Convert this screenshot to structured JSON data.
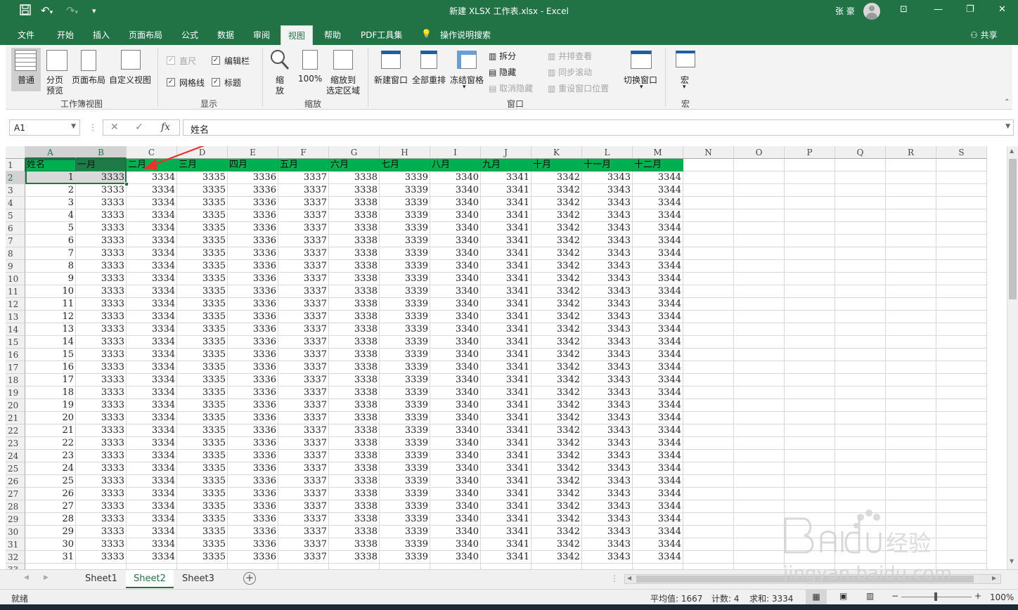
{
  "window": {
    "title": "新建 XLSX 工作表.xlsx  -  Excel",
    "user_name": "张 豪"
  },
  "tabs": [
    {
      "label": "文件"
    },
    {
      "label": "开始"
    },
    {
      "label": "插入"
    },
    {
      "label": "页面布局"
    },
    {
      "label": "公式"
    },
    {
      "label": "数据"
    },
    {
      "label": "审阅"
    },
    {
      "label": "视图"
    },
    {
      "label": "帮助"
    },
    {
      "label": "PDF工具集"
    },
    {
      "label": "操作说明搜索"
    }
  ],
  "share_label": "共享",
  "ribbon": {
    "views": {
      "normal": "普通",
      "pagebreak_1": "分页",
      "pagebreak_2": "预览",
      "pagelayout": "页面布局",
      "custom": "自定义视图",
      "group": "工作簿视图"
    },
    "show": {
      "ruler": "直尺",
      "formulabar": "编辑栏",
      "gridlines": "网格线",
      "headings": "标题",
      "group": "显示"
    },
    "zoom": {
      "zoom_1": "缩",
      "zoom_2": "放",
      "hundred": "100%",
      "tosel_1": "缩放到",
      "tosel_2": "选定区域",
      "group": "缩放"
    },
    "window": {
      "newwin": "新建窗口",
      "arrange": "全部重排",
      "freeze": "冻结窗格",
      "split": "拆分",
      "hide": "隐藏",
      "unhide": "取消隐藏",
      "sidebyside": "并排查看",
      "syncscroll": "同步滚动",
      "resetpos": "重设窗口位置",
      "switch": "切换窗口",
      "group": "窗口"
    },
    "macros": {
      "label": "宏",
      "group": "宏"
    }
  },
  "formula_bar": {
    "name_box": "A1",
    "formula": "姓名"
  },
  "columns": [
    "A",
    "B",
    "C",
    "D",
    "E",
    "F",
    "G",
    "H",
    "I",
    "J",
    "K",
    "L",
    "M",
    "N",
    "O",
    "P",
    "Q",
    "R",
    "S"
  ],
  "header_row": [
    "姓名",
    "一月",
    "二月",
    "三月",
    "四月",
    "五月",
    "六月",
    "七月",
    "八月",
    "九月",
    "十月",
    "十一月",
    "十二月"
  ],
  "rows": [
    {
      "row": "2",
      "name": "1",
      "vals": [
        "3333",
        "3334",
        "3335",
        "3336",
        "3337",
        "3338",
        "3339",
        "3340",
        "3341",
        "3342",
        "3343",
        "3344"
      ]
    },
    {
      "row": "3",
      "name": "2",
      "vals": [
        "3333",
        "3334",
        "3335",
        "3336",
        "3337",
        "3338",
        "3339",
        "3340",
        "3341",
        "3342",
        "3343",
        "3344"
      ]
    },
    {
      "row": "4",
      "name": "3",
      "vals": [
        "3333",
        "3334",
        "3335",
        "3336",
        "3337",
        "3338",
        "3339",
        "3340",
        "3341",
        "3342",
        "3343",
        "3344"
      ]
    },
    {
      "row": "5",
      "name": "4",
      "vals": [
        "3333",
        "3334",
        "3335",
        "3336",
        "3337",
        "3338",
        "3339",
        "3340",
        "3341",
        "3342",
        "3343",
        "3344"
      ]
    },
    {
      "row": "6",
      "name": "5",
      "vals": [
        "3333",
        "3334",
        "3335",
        "3336",
        "3337",
        "3338",
        "3339",
        "3340",
        "3341",
        "3342",
        "3343",
        "3344"
      ]
    },
    {
      "row": "7",
      "name": "6",
      "vals": [
        "3333",
        "3334",
        "3335",
        "3336",
        "3337",
        "3338",
        "3339",
        "3340",
        "3341",
        "3342",
        "3343",
        "3344"
      ]
    },
    {
      "row": "8",
      "name": "7",
      "vals": [
        "3333",
        "3334",
        "3335",
        "3336",
        "3337",
        "3338",
        "3339",
        "3340",
        "3341",
        "3342",
        "3343",
        "3344"
      ]
    },
    {
      "row": "9",
      "name": "8",
      "vals": [
        "3333",
        "3334",
        "3335",
        "3336",
        "3337",
        "3338",
        "3339",
        "3340",
        "3341",
        "3342",
        "3343",
        "3344"
      ]
    },
    {
      "row": "10",
      "name": "9",
      "vals": [
        "3333",
        "3334",
        "3335",
        "3336",
        "3337",
        "3338",
        "3339",
        "3340",
        "3341",
        "3342",
        "3343",
        "3344"
      ]
    },
    {
      "row": "11",
      "name": "10",
      "vals": [
        "3333",
        "3334",
        "3335",
        "3336",
        "3337",
        "3338",
        "3339",
        "3340",
        "3341",
        "3342",
        "3343",
        "3344"
      ]
    },
    {
      "row": "12",
      "name": "11",
      "vals": [
        "3333",
        "3334",
        "3335",
        "3336",
        "3337",
        "3338",
        "3339",
        "3340",
        "3341",
        "3342",
        "3343",
        "3344"
      ]
    },
    {
      "row": "13",
      "name": "12",
      "vals": [
        "3333",
        "3334",
        "3335",
        "3336",
        "3337",
        "3338",
        "3339",
        "3340",
        "3341",
        "3342",
        "3343",
        "3344"
      ]
    },
    {
      "row": "14",
      "name": "13",
      "vals": [
        "3333",
        "3334",
        "3335",
        "3336",
        "3337",
        "3338",
        "3339",
        "3340",
        "3341",
        "3342",
        "3343",
        "3344"
      ]
    },
    {
      "row": "15",
      "name": "14",
      "vals": [
        "3333",
        "3334",
        "3335",
        "3336",
        "3337",
        "3338",
        "3339",
        "3340",
        "3341",
        "3342",
        "3343",
        "3344"
      ]
    },
    {
      "row": "16",
      "name": "15",
      "vals": [
        "3333",
        "3334",
        "3335",
        "3336",
        "3337",
        "3338",
        "3339",
        "3340",
        "3341",
        "3342",
        "3343",
        "3344"
      ]
    },
    {
      "row": "17",
      "name": "16",
      "vals": [
        "3333",
        "3334",
        "3335",
        "3336",
        "3337",
        "3338",
        "3339",
        "3340",
        "3341",
        "3342",
        "3343",
        "3344"
      ]
    },
    {
      "row": "18",
      "name": "17",
      "vals": [
        "3333",
        "3334",
        "3335",
        "3336",
        "3337",
        "3338",
        "3339",
        "3340",
        "3341",
        "3342",
        "3343",
        "3344"
      ]
    },
    {
      "row": "19",
      "name": "18",
      "vals": [
        "3333",
        "3334",
        "3335",
        "3336",
        "3337",
        "3338",
        "3339",
        "3340",
        "3341",
        "3342",
        "3343",
        "3344"
      ]
    },
    {
      "row": "20",
      "name": "19",
      "vals": [
        "3333",
        "3334",
        "3335",
        "3336",
        "3337",
        "3338",
        "3339",
        "3340",
        "3341",
        "3342",
        "3343",
        "3344"
      ]
    },
    {
      "row": "21",
      "name": "20",
      "vals": [
        "3333",
        "3334",
        "3335",
        "3336",
        "3337",
        "3338",
        "3339",
        "3340",
        "3341",
        "3342",
        "3343",
        "3344"
      ]
    },
    {
      "row": "22",
      "name": "21",
      "vals": [
        "3333",
        "3334",
        "3335",
        "3336",
        "3337",
        "3338",
        "3339",
        "3340",
        "3341",
        "3342",
        "3343",
        "3344"
      ]
    },
    {
      "row": "23",
      "name": "22",
      "vals": [
        "3333",
        "3334",
        "3335",
        "3336",
        "3337",
        "3338",
        "3339",
        "3340",
        "3341",
        "3342",
        "3343",
        "3344"
      ]
    },
    {
      "row": "24",
      "name": "23",
      "vals": [
        "3333",
        "3334",
        "3335",
        "3336",
        "3337",
        "3338",
        "3339",
        "3340",
        "3341",
        "3342",
        "3343",
        "3344"
      ]
    },
    {
      "row": "25",
      "name": "24",
      "vals": [
        "3333",
        "3334",
        "3335",
        "3336",
        "3337",
        "3338",
        "3339",
        "3340",
        "3341",
        "3342",
        "3343",
        "3344"
      ]
    },
    {
      "row": "26",
      "name": "25",
      "vals": [
        "3333",
        "3334",
        "3335",
        "3336",
        "3337",
        "3338",
        "3339",
        "3340",
        "3341",
        "3342",
        "3343",
        "3344"
      ]
    },
    {
      "row": "27",
      "name": "26",
      "vals": [
        "3333",
        "3334",
        "3335",
        "3336",
        "3337",
        "3338",
        "3339",
        "3340",
        "3341",
        "3342",
        "3343",
        "3344"
      ]
    },
    {
      "row": "28",
      "name": "27",
      "vals": [
        "3333",
        "3334",
        "3335",
        "3336",
        "3337",
        "3338",
        "3339",
        "3340",
        "3341",
        "3342",
        "3343",
        "3344"
      ]
    },
    {
      "row": "29",
      "name": "28",
      "vals": [
        "3333",
        "3334",
        "3335",
        "3336",
        "3337",
        "3338",
        "3339",
        "3340",
        "3341",
        "3342",
        "3343",
        "3344"
      ]
    },
    {
      "row": "30",
      "name": "29",
      "vals": [
        "3333",
        "3334",
        "3335",
        "3336",
        "3337",
        "3338",
        "3339",
        "3340",
        "3341",
        "3342",
        "3343",
        "3344"
      ]
    },
    {
      "row": "31",
      "name": "30",
      "vals": [
        "3333",
        "3334",
        "3335",
        "3336",
        "3337",
        "3338",
        "3339",
        "3340",
        "3341",
        "3342",
        "3343",
        "3344"
      ]
    },
    {
      "row": "32",
      "name": "31",
      "vals": [
        "3333",
        "3334",
        "3335",
        "3336",
        "3337",
        "3338",
        "3339",
        "3340",
        "3341",
        "3342",
        "3343",
        "3344"
      ]
    }
  ],
  "sheets": [
    {
      "label": "Sheet1"
    },
    {
      "label": "Sheet2"
    },
    {
      "label": "Sheet3"
    }
  ],
  "status": {
    "ready": "就绪",
    "average": "平均值: 1667",
    "count": "计数: 4",
    "sum": "求和: 3334",
    "zoom": "100%"
  },
  "colors": {
    "header_fill": "#00b050",
    "excel_green": "#217346",
    "arrow": "#e8332f"
  }
}
